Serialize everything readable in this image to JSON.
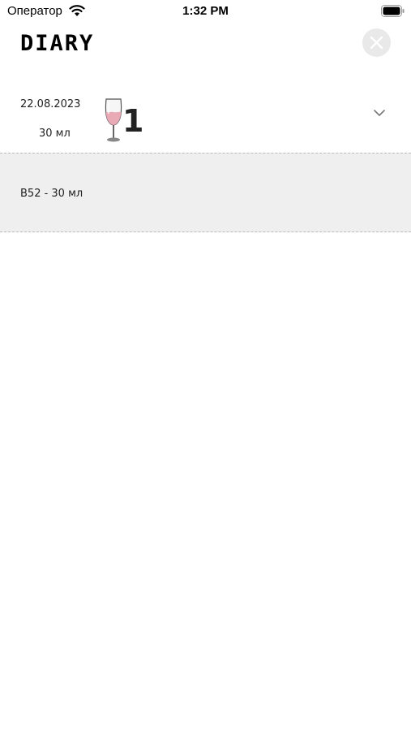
{
  "status_bar": {
    "carrier": "Оператор",
    "time": "1:32 PM"
  },
  "header": {
    "title": "DIARY",
    "close_icon": "close-icon"
  },
  "entries": [
    {
      "date": "22.08.2023",
      "amount": "30 мл",
      "drink_count": "1",
      "glass_icon": "wine-glass-icon",
      "expand_icon": "chevron-down-icon",
      "details": [
        {
          "label": "B52 - 30 мл"
        }
      ]
    }
  ],
  "colors": {
    "details_background": "#efefef",
    "wine": "#e9aab6",
    "close_button_background": "#e9e9e9"
  }
}
